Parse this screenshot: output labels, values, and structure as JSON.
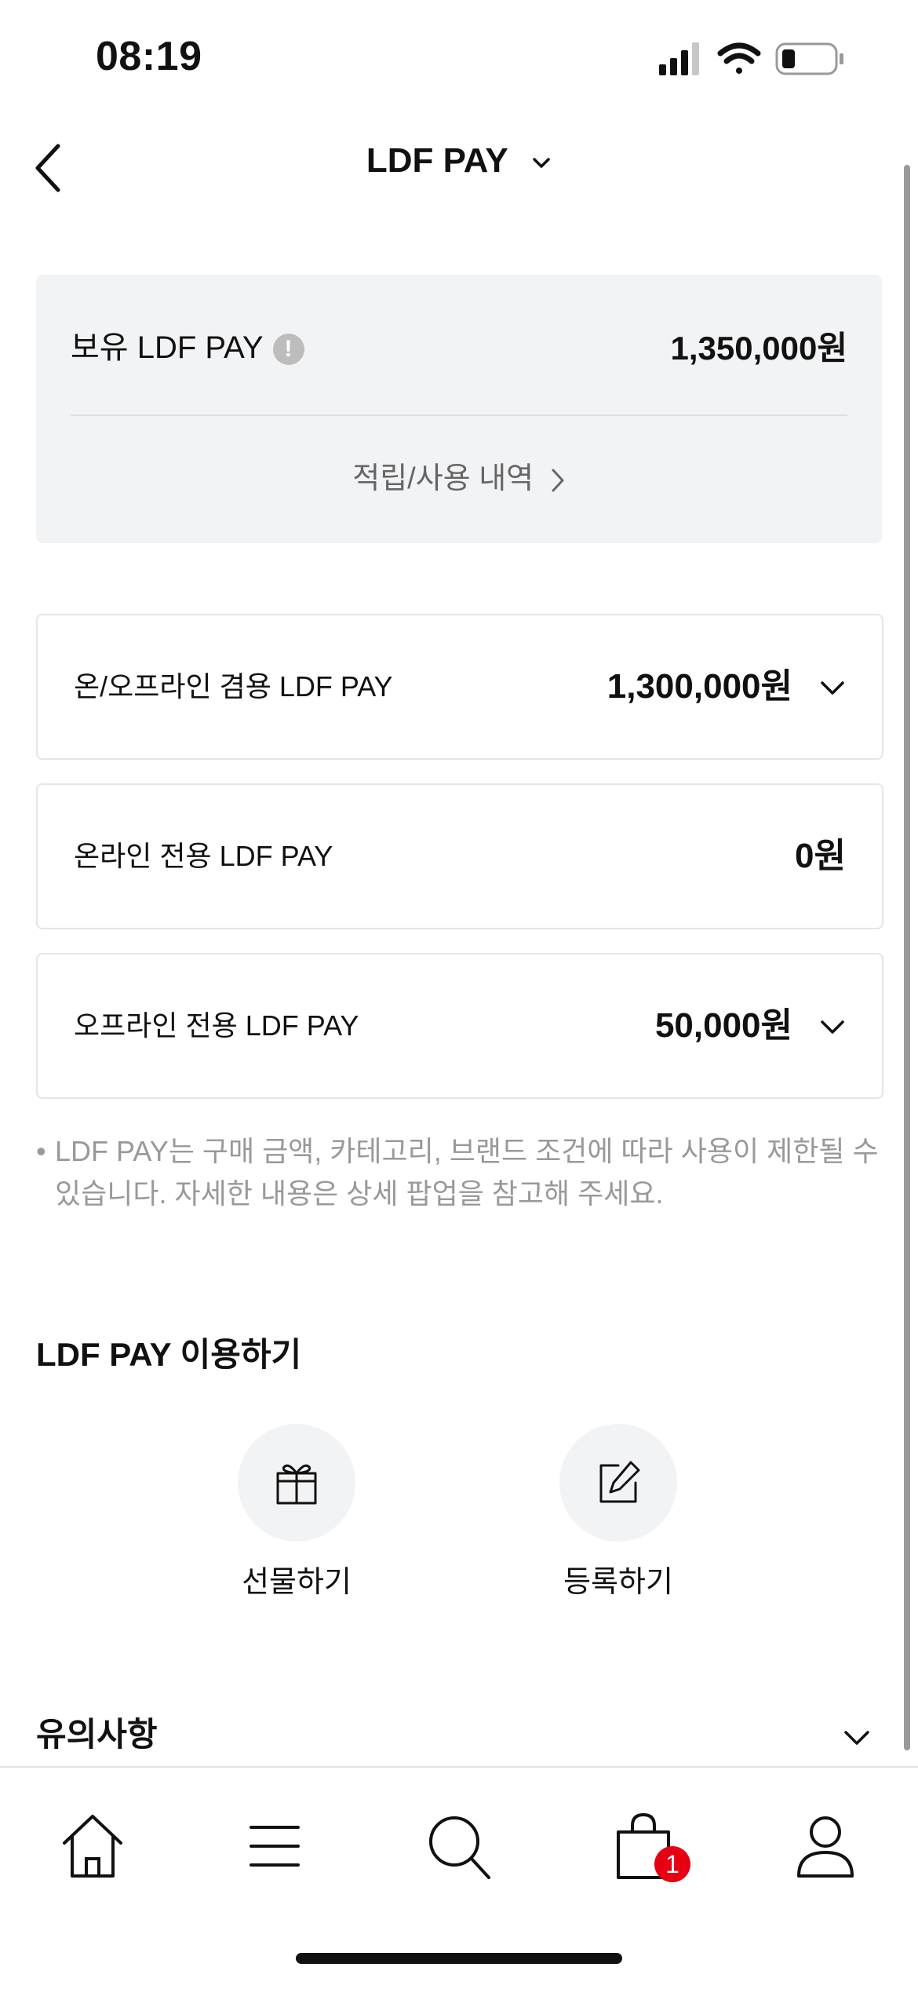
{
  "status": {
    "time": "08:19"
  },
  "header": {
    "title": "LDF PAY"
  },
  "balance": {
    "label": "보유 LDF PAY",
    "info_mark": "!",
    "amount": "1,350,000원",
    "history_link": "적립/사용 내역"
  },
  "pay_cards": [
    {
      "label": "온/오프라인 겸용 LDF PAY",
      "amount": "1,300,000원",
      "expandable": true
    },
    {
      "label": "온라인 전용 LDF PAY",
      "amount": "0원",
      "expandable": false
    },
    {
      "label": "오프라인 전용 LDF PAY",
      "amount": "50,000원",
      "expandable": true
    }
  ],
  "notice": "LDF PAY는 구매 금액, 카테고리, 브랜드 조건에 따라 사용이 제한될 수 있습니다. 자세한 내용은 상세 팝업을 참고해 주세요.",
  "use_section": {
    "title": "LDF PAY 이용하기",
    "items": [
      {
        "label": "선물하기",
        "icon": "gift-icon"
      },
      {
        "label": "등록하기",
        "icon": "edit-icon"
      }
    ]
  },
  "caution": {
    "title": "유의사항"
  },
  "tabbar": {
    "items": [
      "home-icon",
      "menu-icon",
      "search-icon",
      "shopping-bag-icon",
      "user-icon"
    ],
    "cart_badge": "1"
  },
  "colors": {
    "badge": "#e60012",
    "panel": "#f2f3f5",
    "muted": "#999999"
  }
}
